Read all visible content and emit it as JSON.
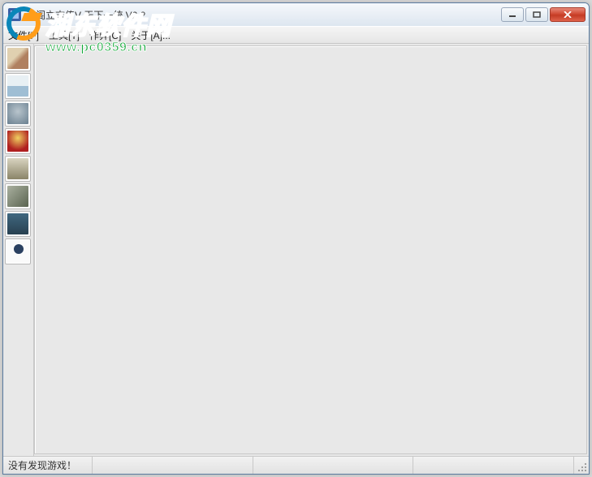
{
  "window": {
    "title": "太阁立志传V    天下一统  V2.2"
  },
  "menu": {
    "file": "文件[F]",
    "tools": "工具[T]",
    "cheat": "作弊[C]",
    "about": "关于[A]..."
  },
  "toolbar": {
    "items": [
      {
        "name": "tool-0"
      },
      {
        "name": "tool-1"
      },
      {
        "name": "tool-2"
      },
      {
        "name": "tool-3"
      },
      {
        "name": "tool-4"
      },
      {
        "name": "tool-5"
      },
      {
        "name": "tool-6"
      },
      {
        "name": "tool-7"
      }
    ]
  },
  "statusbar": {
    "message": "没有发现游戏！"
  },
  "watermark": {
    "site_name": "湘东软件网",
    "url": "www.pc0359.cn"
  }
}
